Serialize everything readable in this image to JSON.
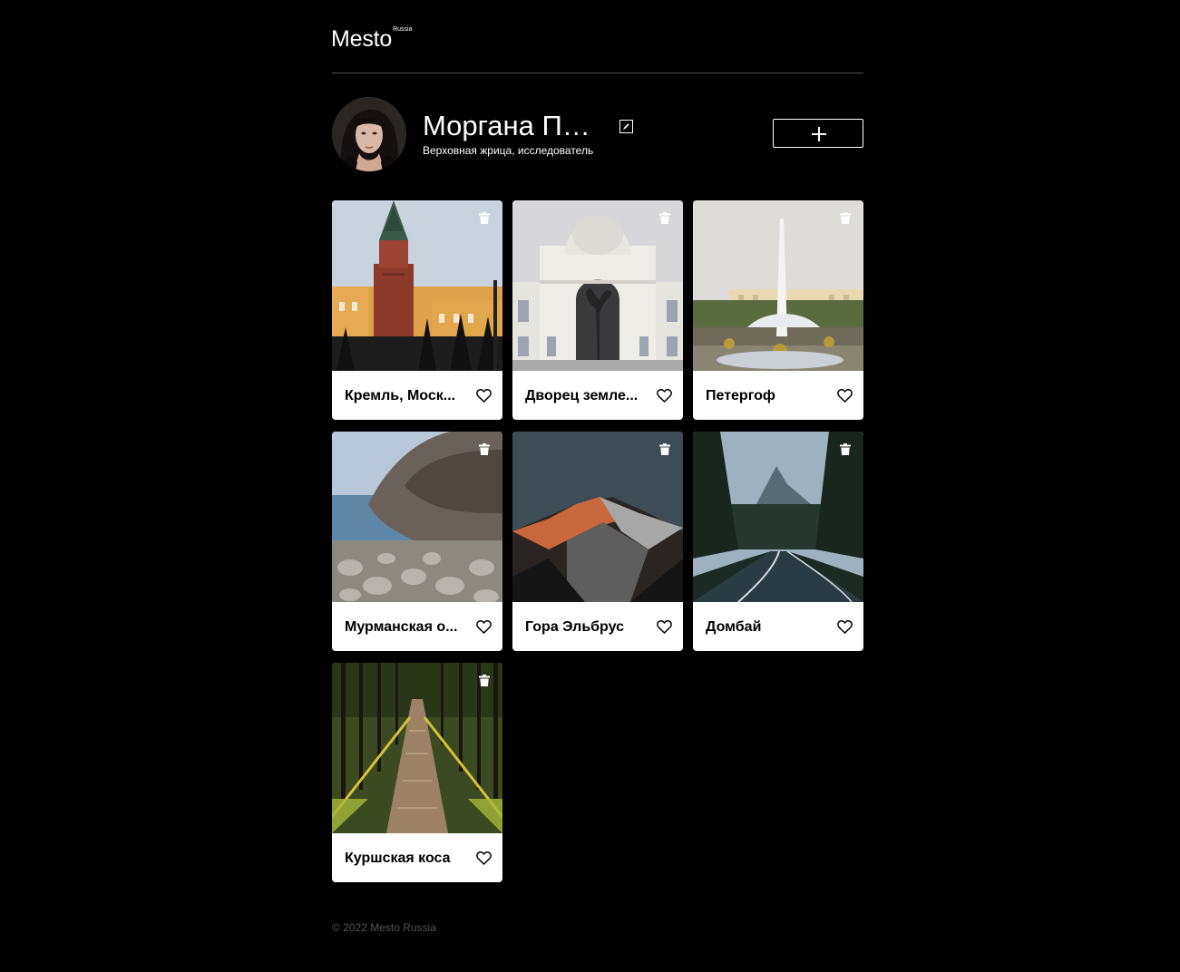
{
  "header": {
    "logo_main": "Mesto",
    "logo_sup": "Russia"
  },
  "profile": {
    "name": "Моргана Пе...",
    "about": "Верховная жрица, исследователь"
  },
  "icons": {
    "edit": "pencil-icon",
    "add": "plus-icon",
    "delete": "trash-icon",
    "like": "heart-outline-icon"
  },
  "cards": [
    {
      "title": "Кремль, Моск...",
      "image": "kremlin-tower"
    },
    {
      "title": "Дворец земле...",
      "image": "palace-arch"
    },
    {
      "title": "Петергоф",
      "image": "fountain-palace"
    },
    {
      "title": "Мурманская о...",
      "image": "rocky-coast"
    },
    {
      "title": "Гора Эльбрус",
      "image": "mountain-peak"
    },
    {
      "title": "Домбай",
      "image": "forest-road"
    },
    {
      "title": "Куршская коса",
      "image": "forest-boardwalk"
    }
  ],
  "footer": {
    "copyright": "© 2022 Mesto Russia"
  },
  "colors": {
    "background": "#000000",
    "card": "#ffffff",
    "divider": "#545454",
    "footer_text": "#545454"
  }
}
